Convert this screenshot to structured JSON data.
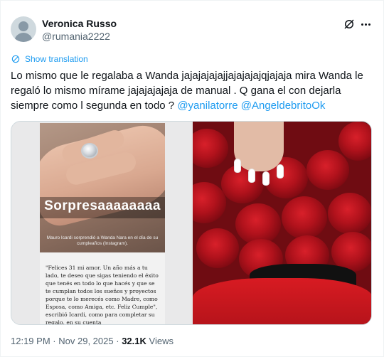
{
  "author": {
    "display_name": "Veronica Russo",
    "handle": "@rumania2222"
  },
  "post": {
    "translate_label": "Show translation",
    "text_main": "Lo mismo que le regalaba a Wanda jajajajajajjajajajajqjajaja mira Wanda le regaló lo mismo mírame jajajajajaja de manual . Q gana el con dejarla siempre como l segunda en todo ?",
    "mentions": [
      "@yanilatorre",
      "@AngeldebritoOk"
    ]
  },
  "media": {
    "left_image": {
      "overlay_text": "Sorpresaaaaaaaa",
      "caption": "Mauro Icardi sorprendió a Wanda Nara en el día de su cumpleaños (Instagram).",
      "article_text": "\"Felices 31 mi amor. Un año más a tu lado, te deseo que sigas teniendo el éxito que tenés en todo lo que hacés y que se te cumplan todos los sueños y proyectos porque te lo merecés como Madre, como Esposa, como Amiga, etc. Feliz Cumple\", escribió Icardi, como para completar su regalo, en su cuenta"
    }
  },
  "footer": {
    "time": "12:19 PM",
    "separator": "·",
    "date": "Nov 29, 2025",
    "views_count": "32.1K",
    "views_label": "Views"
  },
  "colors": {
    "accent": "#1d9bf0",
    "text_primary": "#0f1419",
    "text_secondary": "#536471"
  },
  "icons": [
    "grok-icon",
    "more-icon",
    "translate-icon"
  ]
}
